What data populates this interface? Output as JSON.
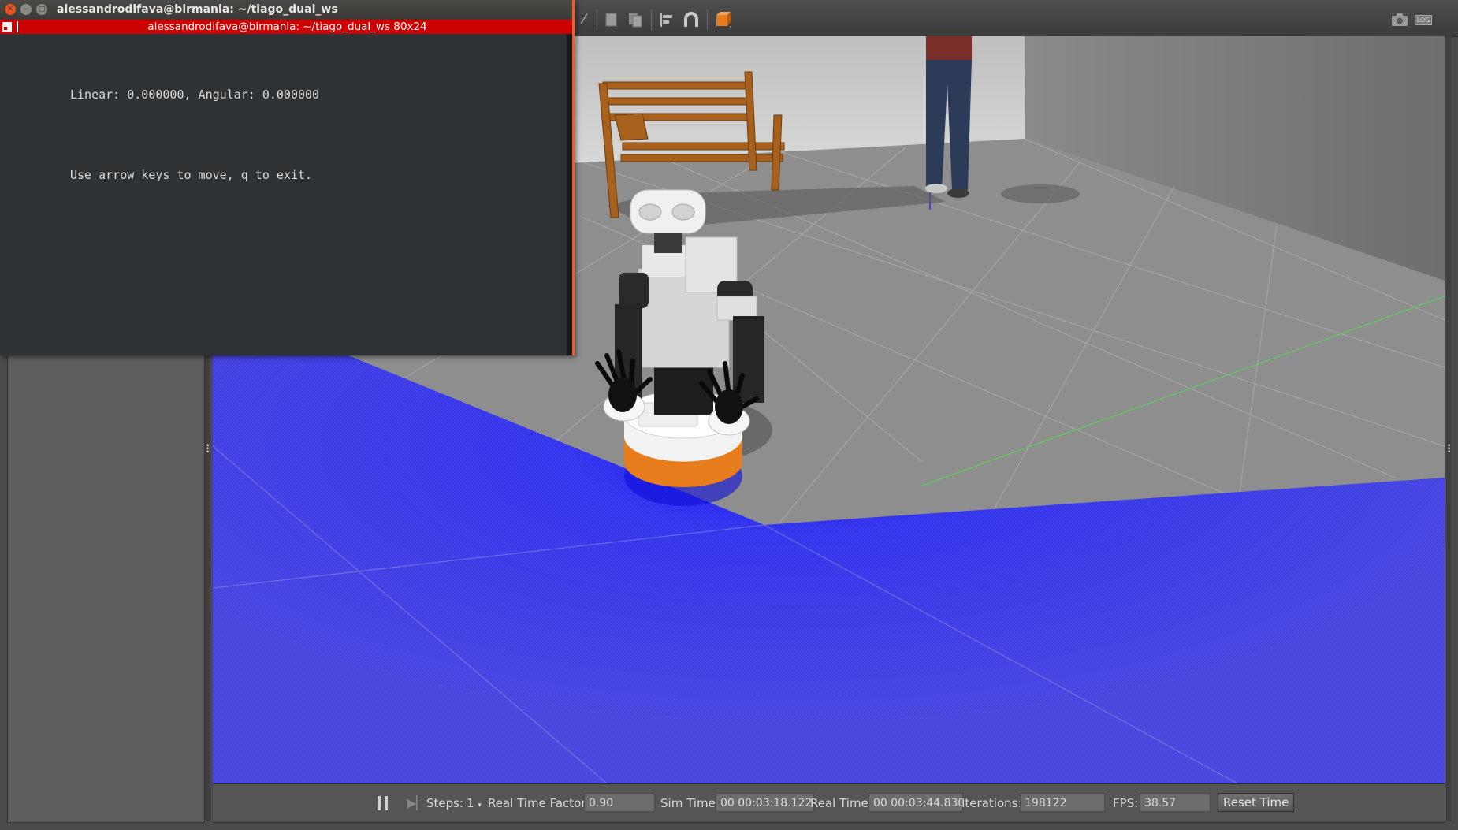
{
  "terminal": {
    "window_title": "alessandrodifava@birmania: ~/tiago_dual_ws",
    "tab_title": "alessandrodifava@birmania: ~/tiago_dual_ws 80x24",
    "lines": [
      "Linear: 0.000000, Angular: 0.000000",
      "Use arrow keys to move, q to exit."
    ],
    "tab_color": "#cc0000"
  },
  "gazebo": {
    "toolbar_icons": [
      "select-icon",
      "copy-icon",
      "paste-icon",
      "align-icon",
      "snap-icon",
      "insert-shape-icon",
      "screenshot-icon",
      "log-icon"
    ],
    "log_label": "LOG",
    "bottom_bar": {
      "steps_label": "Steps:",
      "steps_value": "1",
      "rtf_label": "Real Time Factor:",
      "rtf_value": "0.90",
      "sim_time_label": "Sim Time:",
      "sim_time_value": "00 00:03:18.122",
      "real_time_label": "Real Time:",
      "real_time_value": "00 00:03:44.830",
      "iterations_label": "Iterations:",
      "iterations_value": "198122",
      "fps_label": "FPS:",
      "fps_value": "38.57",
      "reset_time_label": "Reset Time"
    },
    "colors": {
      "ground_plane": "#4040e0",
      "floor": "#8e8e8e",
      "robot_accent": "#e87d1e"
    }
  }
}
